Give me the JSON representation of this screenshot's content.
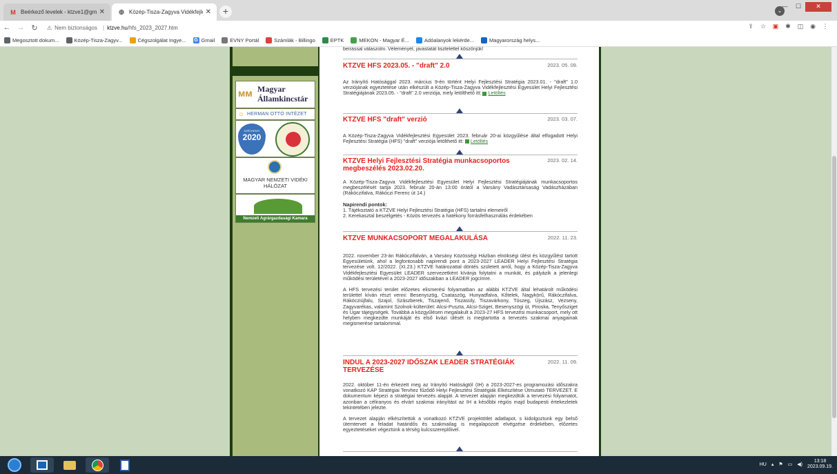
{
  "browser": {
    "tabs": [
      {
        "label": "Beérkező levelek - ktzve1@gmail",
        "active": false
      },
      {
        "label": "Közép-Tisza-Zagyva Vidékfejleszt",
        "active": true
      }
    ],
    "newtab": "+",
    "url_security": "Nem biztonságos",
    "url_host": "ktzve.hu",
    "url_path": "/hfs_2023_2027.htm",
    "bookmarks": [
      {
        "label": "Megosztott dokum...",
        "color": "#5f6368"
      },
      {
        "label": "Közép-Tisza-Zagyv...",
        "color": "#5f6368"
      },
      {
        "label": "Cégszolgálat Ingye...",
        "color": "#e8a400"
      },
      {
        "label": "Gmail",
        "color": "#4285f4",
        "glyph": "G"
      },
      {
        "label": "EVNY Portál",
        "color": "#777"
      },
      {
        "label": "Számlák - Billingo",
        "color": "#e33d3d"
      },
      {
        "label": "EPTK",
        "color": "#2c8c4a"
      },
      {
        "label": "MEKON - Magyar É...",
        "color": "#43a047"
      },
      {
        "label": "Adóalanyok lekérde...",
        "color": "#1e88e5"
      },
      {
        "label": "Magyarország helys...",
        "color": "#1565c0"
      }
    ]
  },
  "sidebar": {
    "logo1_line1": "Magyar",
    "logo1_line2": "Államkincstár",
    "logo2": "HERMAN OTTÓ INTÉZET",
    "logo3_a": "SZÉCHENYI",
    "logo3_b": "2020",
    "logo4": "MAGYAR NEMZETI VIDÉKI HÁLÓZAT",
    "logo5": "Nemzeti Agrárgazdasági Kamara"
  },
  "content": {
    "intro": "beírással válaszolni. Véleményét, javaslatát tisztelettel köszönjük!",
    "items": [
      {
        "title": "KTZVE HFS 2023.05. - \"draft\" 2.0",
        "date": "2023. 05. 09.",
        "body": "Az Irányító Hatósággal 2023. március 9-én történt Helyi Fejlesztési Stratégia 2023.01. - \"draft\" 1.0 verziójának egyeztetése után elkészült a Közép-Tisza-Zagyva Vidékfejlesztési Egyesület Helyi Fejlesztési Stratégiájának 2023.05. - \"draft\" 2.0 verziója, mely letölthető itt:",
        "link": "Letöltés"
      },
      {
        "title": "KTZVE HFS \"draft\" verzió",
        "date": "2023. 03. 07.",
        "body": "A Közép-Tisza-Zagyva Vidékfejlesztési Egyesület 2023. február 20-ai közgyűlése által elfogadott Helyi Fejlesztési Stratégia (HFS) \"draft\" verziója letölthető itt:",
        "link": "Letöltés"
      },
      {
        "title": "KTZVE Helyi Fejlesztési Stratégia munkacsoportos megbeszélés 2023.02.20.",
        "date": "2023. 02. 14.",
        "body": "A Közép-Tisza-Zagyva Vidékfejlesztési Egyesület Helyi Fejlesztési Stratégiájának munkacsoportos megbeszélését tartja 2023. február 20-án 13:00 órától a Varsány Vadásztársaság Vadászházában (Rákóczifalva, Rákóczi Ferenc út 14.)",
        "agenda_title": "Napirendi pontok:",
        "agenda": [
          "1. Tájékoztató a KTZVE Helyi Fejlesztési Stratégia (HFS) tartalmi elemeiről",
          "2. Kerekasztal beszélgetés - Közös tervezés a hatékony forrásfelhasználás érdekében"
        ]
      },
      {
        "title": "KTZVE MUNKACSOPORT MEGALAKULÁSA",
        "date": "2022. 11. 23.",
        "body": "2022. november 23-án Rákóczifalván, a Varsány Közösségi Házban elnökségi ülést és közgyűlést tartott Egyesületünk, ahol a legfontosabb napirendi pont a 2023-2027 LEADER Helyi Fejlesztési Stratégia tervezése volt. 12/2022. (XI.23.) KTZVE határozattal döntés született arról, hogy a Közép-Tisza-Zagyva Vidékfejlesztési Egyesület LEADER szervezetként kívánja folytatni a munkát, és pályázik a jelenlegi működési területével a 2023-2027 időszakban a LEADER jogcímre.",
        "body2": "A HFS tervezési terület előzetes elismerési folyamatban az alábbi KTZVE által lehatárolt működési területtel kíván részt venni: Besenyszög, Csataszög, Hunyadfalva, Kőtelek, Nagykörű, Rákóczifalva, Rákócziújfalu, Szajol, Szászberek, Tiszajenő, Tiszasüly, Tiszavárkony, Tószeg, Újszász, Vezseny, Zagyvarékas, valamint Szolnok-külterület: Alcsi-Puszta, Alcsi-Sziget, Besenyszögi út, Piroska, Tenyősziget és Ugar tájegységek. Továbbá a közgyűlésen megalakult a 2023-27 HFS tervezési munkacsoport, mely ott helyben megkezdte munkáját és első kvázi ülését is megtartotta a tervezés szakmai anyagainak megismerése tartalommal."
      },
      {
        "title": "INDUL A 2023-2027 IDŐSZAK LEADER STRATÉGIÁK TERVEZÉSE",
        "date": "2022. 11. 09.",
        "body": "2022. október 11-én érkezett meg az Irányító Hatóságtól (IH) a 2023-2027-es programozási időszakra vonatkozó KAP Stratégiai Tervhez fűződő Helyi Fejlesztési Stratégiák Elkészítése Útmutató TERVEZET. E dokumentum képezi a stratégiai tervezés alapját. A tervezet alapján megkezdtük a tervezési folyamatot, azonban a céliranyos és elvárt szakmai irányítást az IH a későbbi régiós majd budapesti értekezletek tekintetében jelezte.",
        "body2": "A tervezet alapján elkészítettük a vonatkozó KTZVE projektötlet adatlapot, s kidolgoztunk egy belső ütemtervet a feladat határidős és szakmailag is megalapozott elvégzése érdekében, előzetes egyeztetéseket végeztünk a térség kulcsszereplőivel."
      }
    ]
  },
  "taskbar": {
    "lang": "HU",
    "time": "13:18",
    "date": "2023.09.19."
  }
}
